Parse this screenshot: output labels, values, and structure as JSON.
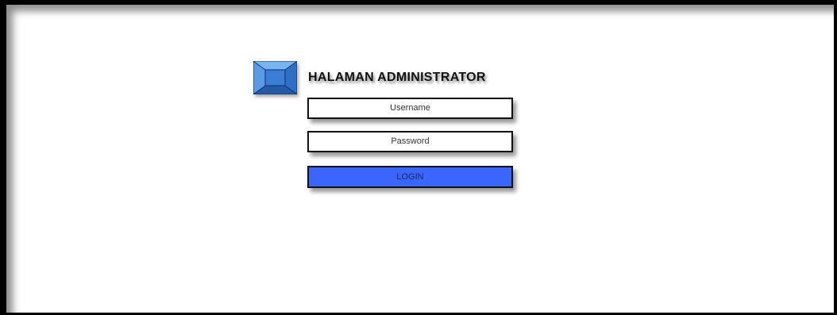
{
  "page": {
    "title": "HALAMAN ADMINISTRATOR",
    "logo_icon": "blue-beveled-square-icon"
  },
  "login_form": {
    "username_placeholder": "Username",
    "password_placeholder": "Password",
    "login_label": "LOGIN"
  },
  "colors": {
    "accent": "#3a66ff",
    "logo_blue": "#3d86d8",
    "border": "#111111"
  }
}
